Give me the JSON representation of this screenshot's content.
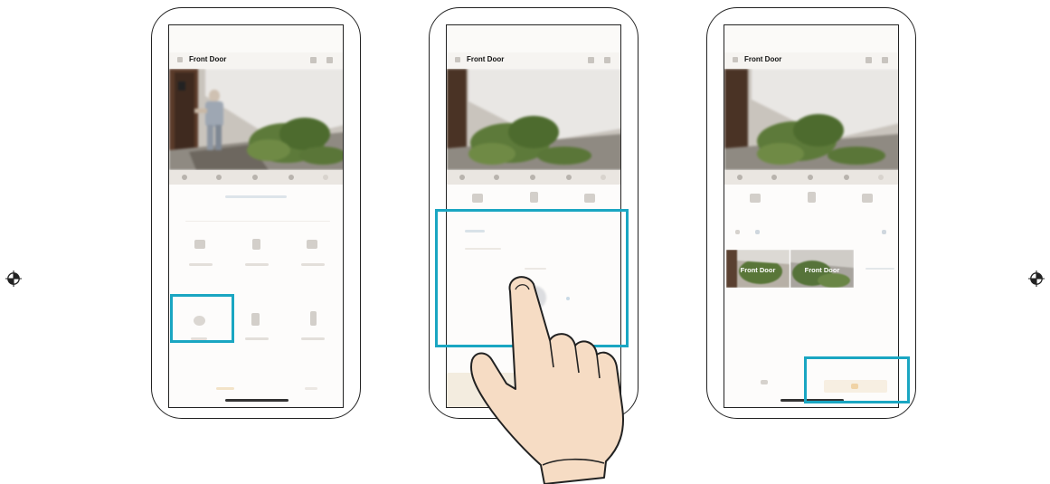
{
  "steps": [
    {
      "camera_name": "Front Door"
    },
    {
      "camera_name": "Front Door"
    },
    {
      "camera_name": "Front Door",
      "playback_clips": [
        {
          "label": "Front Door"
        },
        {
          "label": "Front Door"
        }
      ]
    }
  ],
  "colors": {
    "highlight": "#1aa6c2",
    "frame": "#222222",
    "hand_fill": "#f6dcc4"
  },
  "icons": [
    "registration-mark-icon",
    "hand-pointer-icon"
  ]
}
